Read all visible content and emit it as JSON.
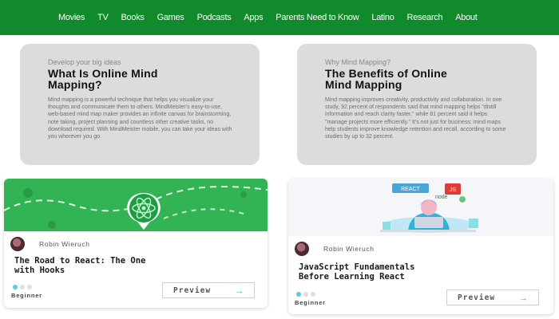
{
  "nav": {
    "items": [
      "Movies",
      "TV",
      "Books",
      "Games",
      "Podcasts",
      "Apps",
      "Parents Need to Know",
      "Latino",
      "Research",
      "About"
    ],
    "background": "#118a2c"
  },
  "info_cards": {
    "left": {
      "eyebrow": "Develop your big ideas",
      "title_line1": "What Is Online Mind",
      "title_line2": "Mapping?",
      "body": "Mind mapping is a powerful technique that helps you visualize your thoughts and communicate them to others. MindMeister's easy-to-use, web-based mind map maker provides an infinite canvas for brainstorming, note taking, project planning and countless other creative tasks, no download required. With MindMeister mobile, you can take your ideas with you wherever you go."
    },
    "right": {
      "eyebrow": "Why Mind Mapping?",
      "title_line1": "The Benefits of Online",
      "title_line2": "Mind Mapping",
      "body": "Mind mapping improves creativity, productivity and collaboration. In one study, 92 percent of respondents said that mind mapping helps \"distill information and reach clarity faster,\" while 81 percent said it helps \"manage projects more efficiently.\" It's not just for business: mind maps help students improve knowledge retention and recall, according to some studies by up to 32 percent."
    }
  },
  "courses": [
    {
      "author": "Robin Wieruch",
      "title_line1": "The Road to React: The One",
      "title_line2": "with Hooks",
      "level": "Beginner",
      "preview_label": "Preview",
      "image_icon": "react-atom-icon"
    },
    {
      "author": "Robin Wieruch",
      "title_line1": "JavaScript Fundamentals",
      "title_line2": "Before Learning React",
      "level": "Beginner",
      "preview_label": "Preview",
      "image_labels": {
        "react": "REACT",
        "js": "JS",
        "node": "node"
      }
    }
  ],
  "colors": {
    "accent_green": "#118a2c",
    "course_green": "#33b454",
    "arrow": "#2fb2c8",
    "dot": "#5cc9d9"
  }
}
